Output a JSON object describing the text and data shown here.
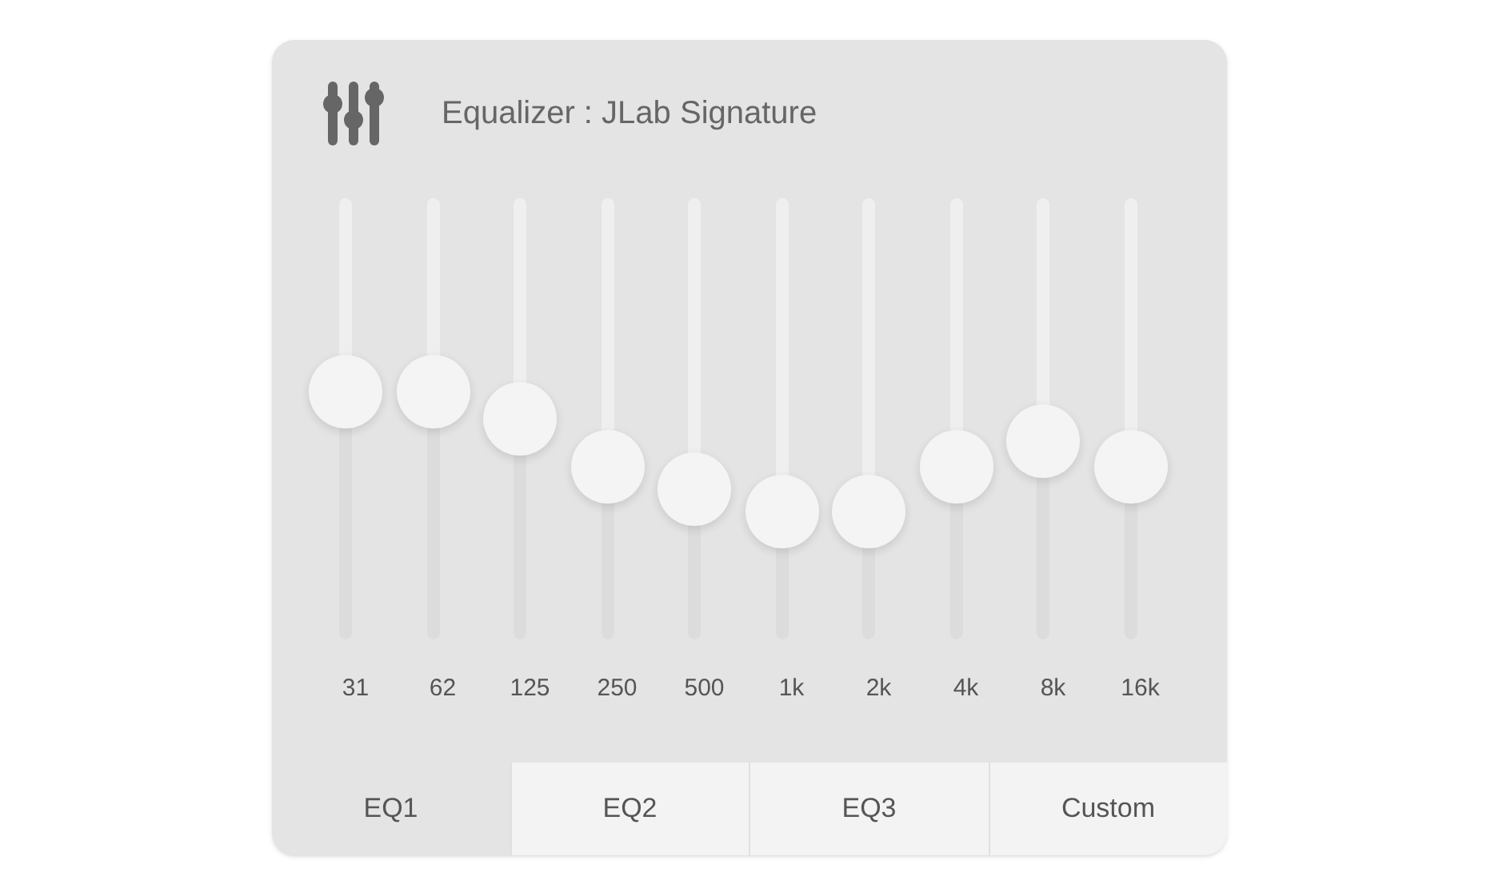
{
  "header": {
    "title": "Equalizer : JLab Signature"
  },
  "bands": [
    {
      "label": "31",
      "level": 0.56
    },
    {
      "label": "62",
      "level": 0.56
    },
    {
      "label": "125",
      "level": 0.5
    },
    {
      "label": "250",
      "level": 0.39
    },
    {
      "label": "500",
      "level": 0.34
    },
    {
      "label": "1k",
      "level": 0.29
    },
    {
      "label": "2k",
      "level": 0.29
    },
    {
      "label": "4k",
      "level": 0.39
    },
    {
      "label": "8k",
      "level": 0.45
    },
    {
      "label": "16k",
      "level": 0.39
    }
  ],
  "presets": [
    {
      "label": "EQ1",
      "selected": true
    },
    {
      "label": "EQ2",
      "selected": false
    },
    {
      "label": "EQ3",
      "selected": false
    },
    {
      "label": "Custom",
      "selected": false
    }
  ]
}
